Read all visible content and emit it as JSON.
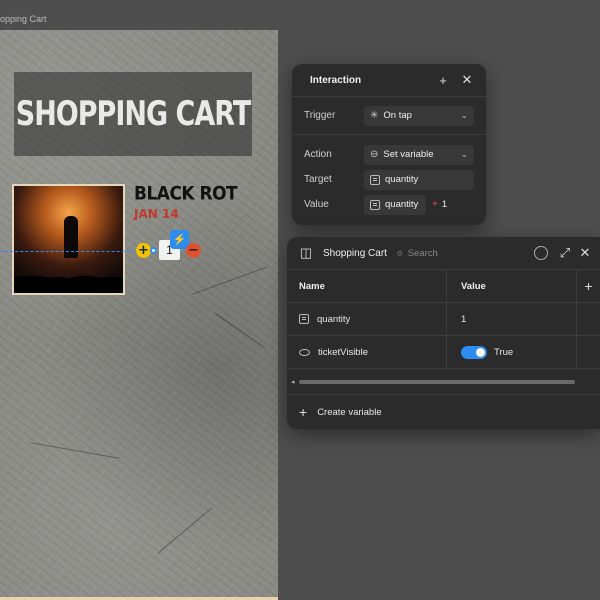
{
  "canvas": {
    "frame_label": "opping Cart"
  },
  "frame": {
    "title": "SHOPPING CART",
    "item": {
      "band": "BLACK ROT",
      "date": "JAN 14",
      "quantity_display": "1",
      "plus_label": "+",
      "minus_label": "−"
    }
  },
  "interaction_panel": {
    "title": "Interaction",
    "trigger_label": "Trigger",
    "trigger_value": "On tap",
    "action_label": "Action",
    "action_value": "Set variable",
    "target_label": "Target",
    "target_value": "quantity",
    "value_label": "Value",
    "value_variable": "quantity",
    "value_operator": "+",
    "value_operand": "1"
  },
  "variables_panel": {
    "title": "Shopping Cart",
    "search_placeholder": "Search",
    "columns": [
      "Name",
      "Value"
    ],
    "rows": [
      {
        "name": "quantity",
        "value": "1",
        "type": "number"
      },
      {
        "name": "ticketVisible",
        "value": "True",
        "type": "boolean"
      }
    ],
    "create_label": "Create variable"
  },
  "colors": {
    "accent": "#2d8cf0",
    "panel_bg": "#2b2b2b",
    "canvas_bg": "#4e4e4e",
    "date_red": "#c0392b",
    "plus_yellow": "#f2c400",
    "minus_red": "#e0502e"
  },
  "icons": [
    "add-icon",
    "close-icon",
    "sparkle-icon",
    "set-variable-icon",
    "variable-icon",
    "panel-layout-icon",
    "search-icon",
    "filter-icon",
    "expand-icon",
    "eye-icon",
    "interaction-icon"
  ]
}
